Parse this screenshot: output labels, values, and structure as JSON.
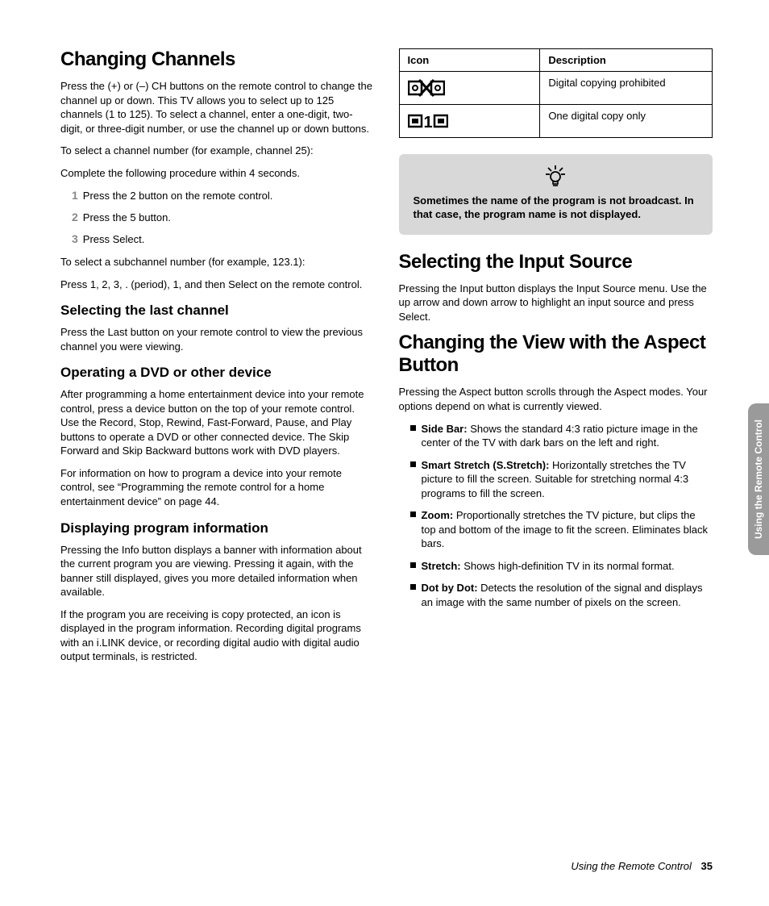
{
  "left": {
    "h1": "Changing Channels",
    "p1": "Press the (+) or (–) CH buttons on the remote control to change the channel up or down. This TV allows you to select up to 125 channels (1 to 125). To select a channel, enter a one-digit, two-digit, or three-digit number, or use the channel up or down buttons.",
    "p2": "To select a channel number (for example, channel 25):",
    "p3": "Complete the following procedure within 4 seconds.",
    "steps": {
      "n1": "1",
      "s1": "Press the 2 button on the remote control.",
      "n2": "2",
      "s2": "Press the 5 button.",
      "n3": "3",
      "s3": "Press Select."
    },
    "p4": "To select a subchannel number (for example, 123.1):",
    "p5": "Press 1, 2, 3, . (period), 1, and then Select on the remote control.",
    "h2a": "Selecting the last channel",
    "p6": "Press the Last button on your remote control to view the previous channel you were viewing.",
    "h2b": "Operating a DVD or other device",
    "p7": "After programming a home entertainment device into your remote control, press a device button on the top of your remote control. Use the Record, Stop, Rewind, Fast-Forward, Pause, and Play buttons to operate a DVD or other connected device. The Skip Forward and Skip Backward buttons work with DVD players.",
    "p8": "For information on how to program a device into your remote control, see “Programming the remote control for a home entertainment device” on page 44.",
    "h2c": "Displaying program information",
    "p9": "Pressing the Info button displays a banner with information about the current program you are viewing. Pressing it again, with the banner still displayed, gives you more detailed information when available.",
    "p10": "If the program you are receiving is copy protected, an icon is displayed in the program information. Recording digital programs with an i.LINK device, or recording digital audio with digital audio output terminals, is restricted."
  },
  "right": {
    "table": {
      "th1": "Icon",
      "th2": "Description",
      "r1": "Digital copying prohibited",
      "r2": "One digital copy only"
    },
    "tip": "Sometimes the name of the program is not broadcast. In that case, the program name is not displayed.",
    "h1a": "Selecting the Input Source",
    "p1": "Pressing the Input button displays the Input Source menu. Use the up arrow and down arrow to highlight an input source and press Select.",
    "h1b": "Changing the View with the Aspect Button",
    "p2": "Pressing the Aspect button scrolls through the Aspect modes. Your options depend on what is currently viewed.",
    "aspect": {
      "t1": "Side Bar:",
      "d1": " Shows the standard 4:3 ratio picture image in the center of the TV with dark bars on the left and right.",
      "t2": "Smart Stretch (S.Stretch):",
      "d2": " Horizontally stretches the TV picture to fill the screen. Suitable for stretching normal 4:3 programs to fill the screen.",
      "t3": "Zoom:",
      "d3": " Proportionally stretches the TV picture, but clips the top and bottom of the image to fit the screen. Eliminates black bars.",
      "t4": "Stretch:",
      "d4": " Shows high-definition TV in its normal format.",
      "t5": "Dot by Dot:",
      "d5": " Detects the resolution of the signal and displays an image with the same number of pixels on the screen."
    }
  },
  "sidetab": "Using the Remote Control",
  "footer": {
    "title": "Using the Remote Control",
    "page": "35"
  }
}
